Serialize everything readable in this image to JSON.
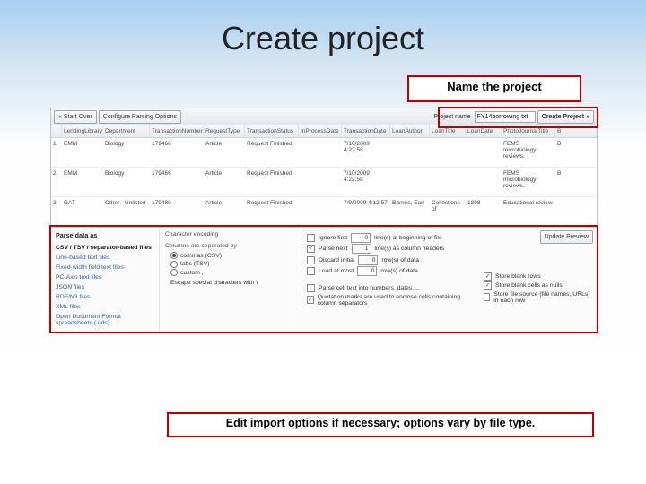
{
  "slide": {
    "title": "Create project",
    "callout_top": "Name the project",
    "callout_bottom": "Edit import options if necessary; options vary by file type."
  },
  "topbar": {
    "start_over": "Start Over",
    "configure": "Configure Parsing Options",
    "project_name_label": "Project name",
    "project_name_value": "FY14borrowing txt",
    "create_project": "Create Project"
  },
  "grid": {
    "headers": [
      "LendingLibrary",
      "Department",
      "TransactionNumber",
      "RequestType",
      "TransactionStatus",
      "InProcessDate",
      "TransactionDate",
      "LoanAuthor",
      "LoanTitle",
      "LoanDate",
      "PhotoJournalTitle",
      "B"
    ],
    "rows": [
      [
        "1.",
        "EMM",
        "Biology",
        "179466",
        "Article",
        "Request Finished",
        "",
        "7/10/2009 4:22:58",
        "",
        "",
        "",
        "FEMS microbiology reviews.",
        "B"
      ],
      [
        "2.",
        "EMM",
        "Biology",
        "179466",
        "Article",
        "Request Finished",
        "",
        "7/10/2009 4:22:58",
        "",
        "",
        "",
        "FEMS microbiology reviews.",
        "B"
      ],
      [
        "3.",
        "GAT",
        "Other - Unlisted",
        "179480",
        "Article",
        "Request Finished",
        "",
        "7/9/2009 4:12:57",
        "Barnes, Earl",
        "Collections of",
        "1898",
        "Educational review.",
        ""
      ]
    ]
  },
  "parse": {
    "header": "Parse data as",
    "formats": [
      "CSV / TSV / separator-based files",
      "Line-based text files",
      "Fixed-width field text files",
      "PC-Axis text files",
      "JSON files",
      "RDF/N3 files",
      "XML files",
      "Open Document Format spreadsheets (.ods)"
    ],
    "encoding_label": "Character encoding",
    "sep_label": "Columns are separated by",
    "seps": [
      "commas (CSV)",
      "tabs (TSV)",
      "custom ,"
    ],
    "escape": "Escape special characters with \\",
    "update_preview": "Update Preview",
    "opts": {
      "ignore_first": "Ignore first",
      "ignore_first_tail": "line(s) at beginning of file",
      "parse_next": "Parse next",
      "parse_next_tail": "line(s) as column headers",
      "discard_initial": "Discard initial",
      "discard_tail": "row(s) of data",
      "load_at_most": "Load at most",
      "load_tail": "row(s) of data",
      "parse_cell": "Parse cell text into numbers, dates, ...",
      "quotation": "Quotation marks are used to enclose cells containing column separators",
      "blank_rows": "Store blank rows",
      "blank_cells": "Store blank cells as nulls",
      "file_source": "Store file source (file names, URLs) in each row"
    },
    "vals": {
      "ignore_first": "0",
      "parse_next": "1",
      "discard": "0",
      "load": "0"
    }
  }
}
